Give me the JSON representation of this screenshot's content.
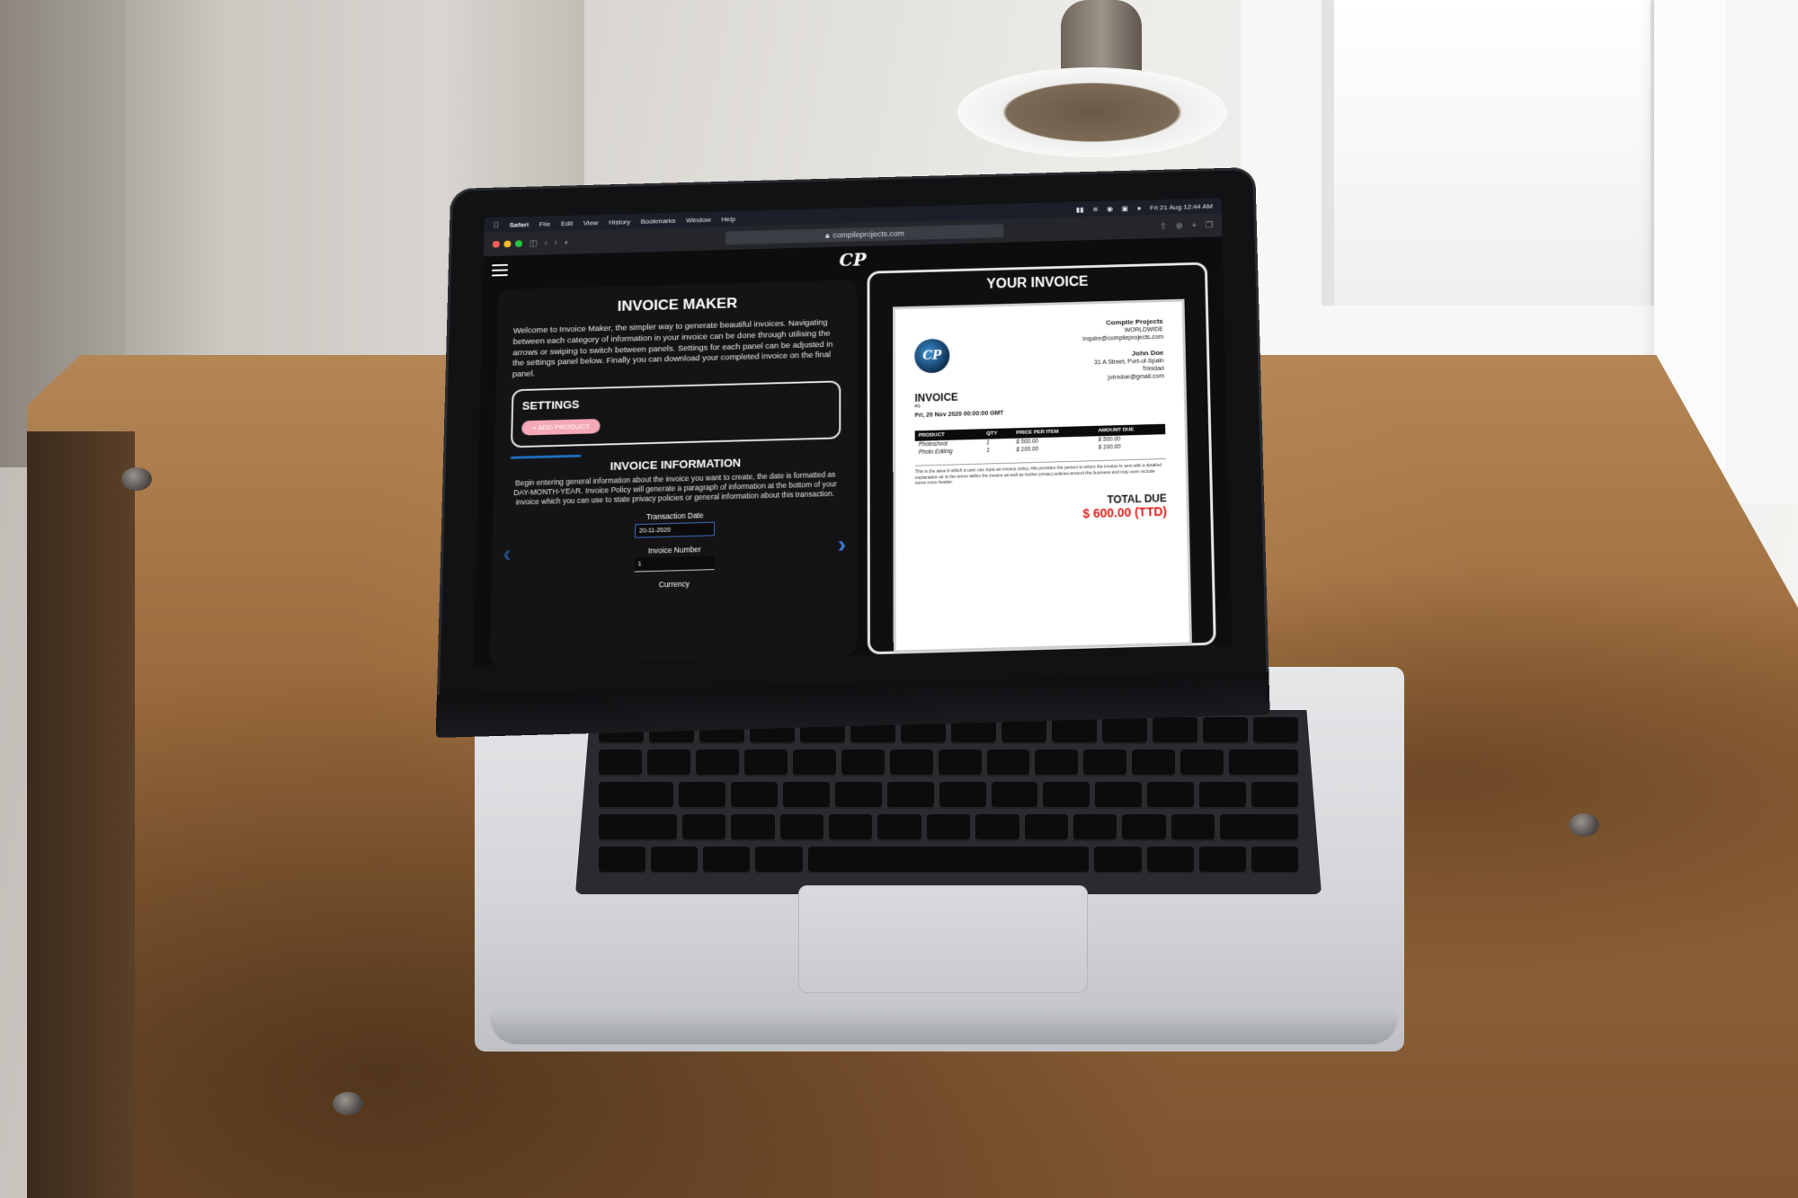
{
  "menubar": {
    "app": "Safari",
    "items": [
      "File",
      "Edit",
      "View",
      "History",
      "Bookmarks",
      "Window",
      "Help"
    ],
    "clock": "Fri 21 Aug  12:44 AM"
  },
  "browser": {
    "url": "compileprojects.com"
  },
  "site": {
    "logo": "CP"
  },
  "left_panel": {
    "title": "INVOICE MAKER",
    "intro": "Welcome to Invoice Maker, the simpler way to generate beautiful invoices. Navigating between each category of information in your invoice can be done through utilising the arrows or swiping to switch between panels. Settings for each panel can be adjusted in the settings panel below. Finally you can download your completed invoice on the final panel.",
    "settings_title": "SETTINGS",
    "add_product_label": "+ ADD PRODUCT",
    "info_title": "INVOICE INFORMATION",
    "info_text": "Begin entering general information about the invoice you want to create, the date is formatted as DAY-MONTH-YEAR. Invoice Policy will generate a paragraph of information at the bottom of your invoice which you can use to state privacy policies or general information about this transaction.",
    "transaction_date_label": "Transaction Date",
    "transaction_date_value": "20-11-2020",
    "invoice_number_label": "Invoice Number",
    "invoice_number_value": "1",
    "currency_label": "Currency"
  },
  "right_panel": {
    "title": "YOUR INVOICE",
    "invoice": {
      "logo": "CP",
      "company_name": "Compile Projects",
      "company_region": "WORLDWIDE",
      "company_email": "inquire@compileprojects.com",
      "client_name": "John Doe",
      "client_address_1": "31 A Street, Port-of-Spain",
      "client_address_2": "Trinidad",
      "client_email": "johndoe@gmail.com",
      "title": "INVOICE",
      "number": "#1",
      "date": "Fri, 20 Nov 2020 00:00:00 GMT",
      "columns": [
        "PRODUCT",
        "QTY",
        "PRICE PER ITEM",
        "AMOUNT DUE"
      ],
      "rows": [
        [
          "Photoshoot",
          "1",
          "$ 500.00",
          "$ 500.00"
        ],
        [
          "Photo Editing",
          "1",
          "$ 100.00",
          "$ 100.00"
        ]
      ],
      "policy": "This is the area in which a user can input an invoice policy, this provides the person to whom the invoice is sent with a detailed explanation as to the terms within the invoice as well as further privacy policies around this business and may even include some more header.",
      "total_label": "TOTAL DUE",
      "total_value": "$ 600.00 (TTD)",
      "total_color": "#e1201d"
    }
  },
  "accent_color": "#3f7fd8"
}
